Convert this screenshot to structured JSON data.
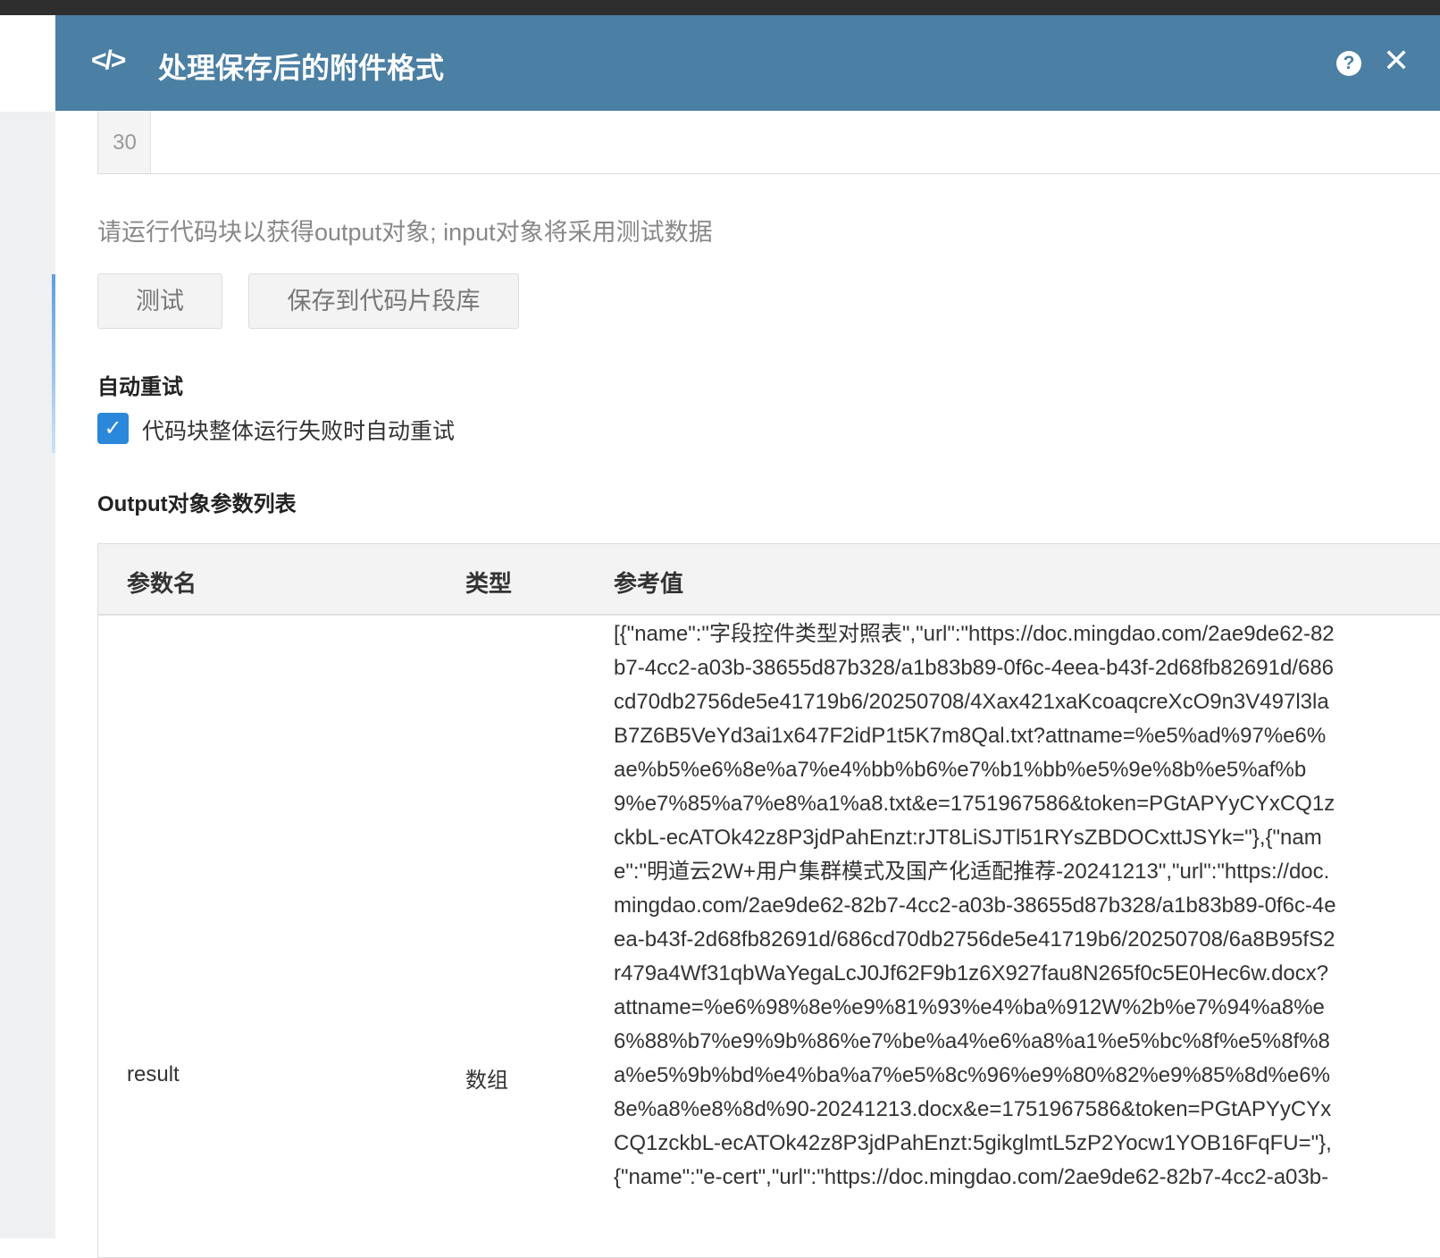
{
  "header": {
    "title": "处理保存后的附件格式",
    "code_icon": "</>",
    "help_icon": "?",
    "close_icon": "✕"
  },
  "editor": {
    "line_number": "30"
  },
  "hint": "请运行代码块以获得output对象; input对象将采用测试数据",
  "buttons": {
    "test": "测试",
    "save_snippet": "保存到代码片段库"
  },
  "retry": {
    "heading": "自动重试",
    "checkbox_label": "代码块整体运行失败时自动重试",
    "checked": true
  },
  "output": {
    "heading": "Output对象参数列表",
    "columns": [
      "参数名",
      "类型",
      "参考值"
    ],
    "rows": [
      {
        "name": "result",
        "type": "数组",
        "value_lines": [
          "[{\"name\":\"字段控件类型对照表\",\"url\":\"https://doc.mingdao.com/2ae9de62-82",
          "b7-4cc2-a03b-38655d87b328/a1b83b89-0f6c-4eea-b43f-2d68fb82691d/686",
          "cd70db2756de5e41719b6/20250708/4Xax421xaKcoaqcreXcO9n3V497l3la",
          "B7Z6B5VeYd3ai1x647F2idP1t5K7m8Qal.txt?attname=%e5%ad%97%e6%",
          "ae%b5%e6%8e%a7%e4%bb%b6%e7%b1%bb%e5%9e%8b%e5%af%b",
          "9%e7%85%a7%e8%a1%a8.txt&e=1751967586&token=PGtAPYyCYxCQ1z",
          "ckbL-ecATOk42z8P3jdPahEnzt:rJT8LiSJTl51RYsZBDOCxttJSYk=\"},{\"nam",
          "e\":\"明道云2W+用户集群模式及国产化适配推荐-20241213\",\"url\":\"https://doc.",
          "mingdao.com/2ae9de62-82b7-4cc2-a03b-38655d87b328/a1b83b89-0f6c-4e",
          "ea-b43f-2d68fb82691d/686cd70db2756de5e41719b6/20250708/6a8B95fS2",
          "r479a4Wf31qbWaYegaLcJ0Jf62F9b1z6X927fau8N265f0c5E0Hec6w.docx?",
          "attname=%e6%98%8e%e9%81%93%e4%ba%912W%2b%e7%94%a8%e",
          "6%88%b7%e9%9b%86%e7%be%a4%e6%a8%a1%e5%bc%8f%e5%8f%8",
          "a%e5%9b%bd%e4%ba%a7%e5%8c%96%e9%80%82%e9%85%8d%e6%",
          "8e%a8%e8%8d%90-20241213.docx&e=1751967586&token=PGtAPYyCYx",
          "CQ1zckbL-ecATOk42z8P3jdPahEnzt:5gikglmtL5zP2Yocw1YOB16FqFU=\"},",
          "{\"name\":\"e-cert\",\"url\":\"https://doc.mingdao.com/2ae9de62-82b7-4cc2-a03b-"
        ]
      }
    ]
  }
}
